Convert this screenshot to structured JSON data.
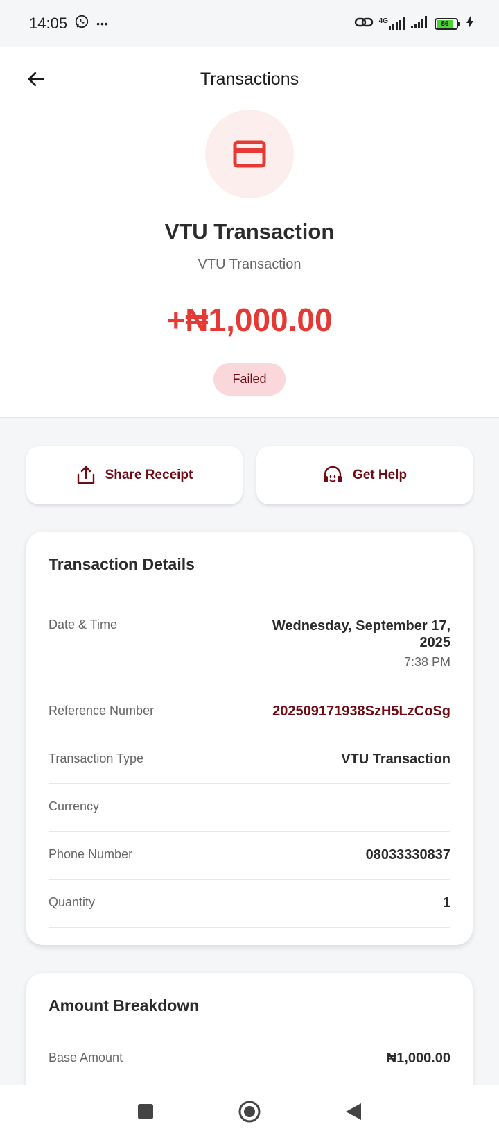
{
  "status_bar": {
    "time": "14:05",
    "more": "•••",
    "network": "4G",
    "battery": "86"
  },
  "header": {
    "title": "Transactions"
  },
  "hero": {
    "title": "VTU Transaction",
    "subtitle": "VTU Transaction",
    "amount": "+₦1,000.00",
    "status": "Failed",
    "icon": "credit-card-icon"
  },
  "actions": {
    "share_label": "Share Receipt",
    "help_label": "Get Help"
  },
  "details": {
    "title": "Transaction Details",
    "date_label": "Date & Time",
    "date_value": "Wednesday, September 17, 2025",
    "time_value": "7:38 PM",
    "ref_label": "Reference Number",
    "ref_value": "202509171938SzH5LzCoSg",
    "type_label": "Transaction Type",
    "type_value": "VTU Transaction",
    "currency_label": "Currency",
    "currency_value": "",
    "phone_label": "Phone Number",
    "phone_value": "08033330837",
    "quantity_label": "Quantity",
    "quantity_value": "1"
  },
  "breakdown": {
    "title": "Amount Breakdown",
    "base_label": "Base Amount",
    "base_value": "₦1,000.00"
  },
  "colors": {
    "accent_red": "#e53935",
    "dark_maroon": "#6e0b14",
    "failed_bg": "#f9d7da",
    "icon_bg": "#fdeeee"
  }
}
